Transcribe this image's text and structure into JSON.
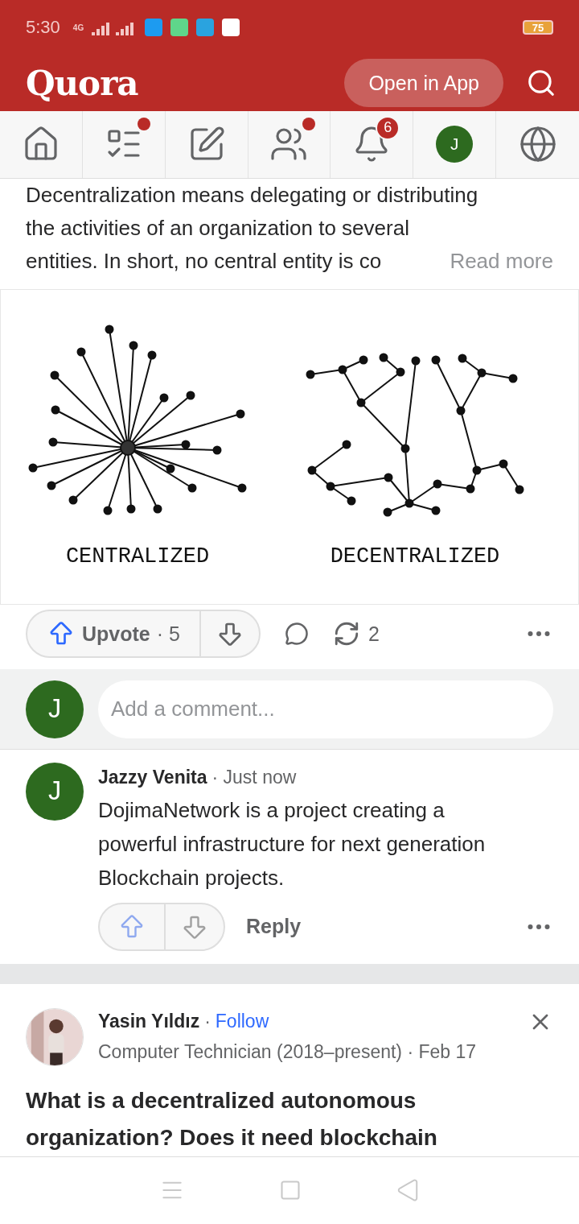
{
  "status_bar": {
    "time": "5:30",
    "network": "4G",
    "battery": "75"
  },
  "header": {
    "logo": "Quora",
    "open_button": "Open in App"
  },
  "nav": [
    {
      "kind": "home",
      "dot": false
    },
    {
      "kind": "list",
      "dot": true
    },
    {
      "kind": "write",
      "dot": false
    },
    {
      "kind": "people",
      "dot": true
    },
    {
      "kind": "bell",
      "dot": false,
      "badge": "6"
    },
    {
      "kind": "avatar",
      "dot": false,
      "initial": "J"
    },
    {
      "kind": "globe",
      "dot": false
    }
  ],
  "answer": {
    "lines": [
      "Decentralization means delegating or distributing",
      "the activities of an organization to several",
      "entities. In short, no central entity is co"
    ],
    "read_more": "Read more",
    "figure": {
      "left_label": "CENTRALIZED",
      "right_label": "DECENTRALIZED"
    },
    "actions": {
      "upvote": "Upvote",
      "upvote_count": "· 5",
      "share_count": "2"
    }
  },
  "comment_box": {
    "initial": "J",
    "placeholder": "Add a comment..."
  },
  "comment": {
    "initial": "J",
    "author": "Jazzy Venita",
    "time": "· Just now",
    "text": "DojimaNetwork is a project creating a powerful infrastructure for next generation Blockchain projects.",
    "reply": "Reply"
  },
  "next_post": {
    "author": "Yasin Yıldız",
    "separator": "·",
    "follow": "Follow",
    "credential": "Computer Technician (2018–present) · Feb 17",
    "question": "What is a decentralized autonomous organization? Does it need blockchain"
  }
}
